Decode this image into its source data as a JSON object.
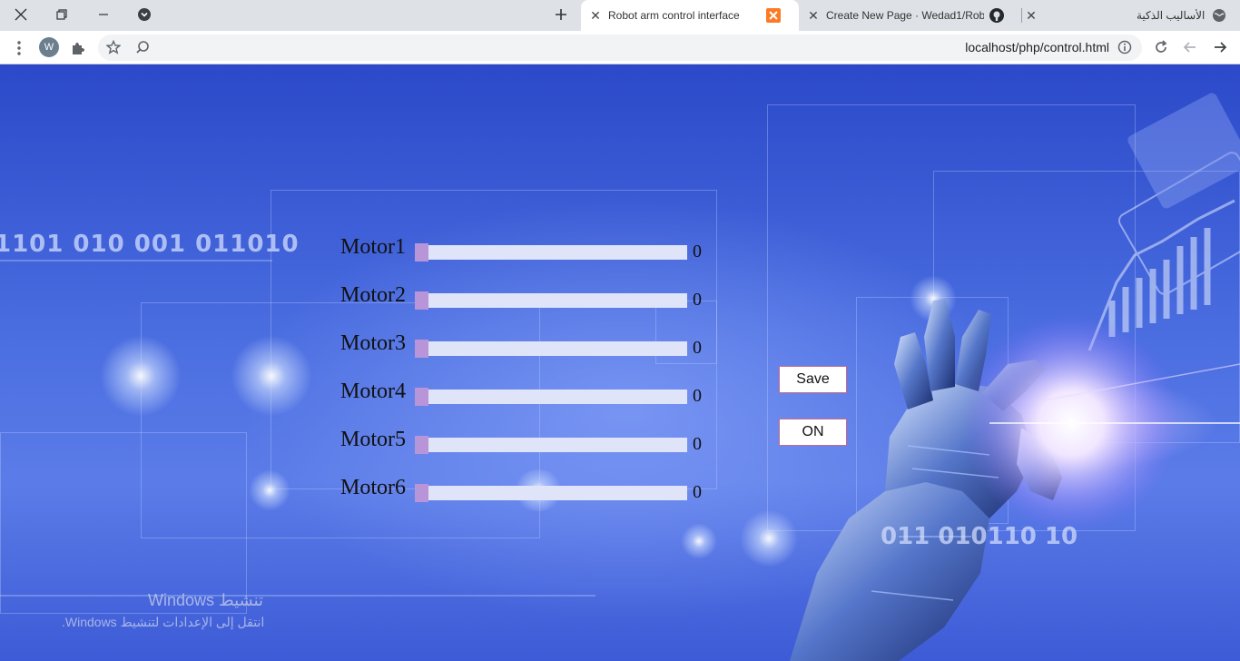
{
  "browser": {
    "tabs": [
      {
        "title": "Robot arm control interface",
        "active": true
      },
      {
        "title": "Create New Page · Wedad1/Robo",
        "active": false
      },
      {
        "title": "الأساليب الذكية",
        "active": false
      }
    ],
    "url": "localhost/php/control.html",
    "profile_initial": "W",
    "icons": {
      "window_close": "close-icon",
      "window_restore": "restore-icon",
      "window_minimize": "minimize-icon",
      "tab_search": "tab-search-icon",
      "new_tab": "plus-icon",
      "menu": "kebab-menu-icon",
      "extensions": "puzzle-icon",
      "bookmark": "star-icon",
      "lens": "lens-search-icon",
      "site_info": "info-icon",
      "reload": "reload-icon",
      "back": "arrow-left-icon",
      "forward": "arrow-right-icon"
    }
  },
  "page": {
    "background_binary": [
      "1101  010  001  011010",
      "011  010110  10"
    ],
    "motors": [
      {
        "label": "Motor1",
        "value": "0",
        "position": 0
      },
      {
        "label": "Motor2",
        "value": "0",
        "position": 0
      },
      {
        "label": "Motor3",
        "value": "0",
        "position": 0
      },
      {
        "label": "Motor4",
        "value": "0",
        "position": 0
      },
      {
        "label": "Motor5",
        "value": "0",
        "position": 0
      },
      {
        "label": "Motor6",
        "value": "0",
        "position": 0
      }
    ],
    "buttons": {
      "save": "Save",
      "on": "ON"
    },
    "colors": {
      "slider_thumb": "#b894d9",
      "slider_track": "#dfe4f8",
      "button_border": "#c86a8a"
    }
  },
  "windows_watermark": {
    "title": "تنشيط Windows",
    "subtitle": "انتقل إلى الإعدادات لتنشيط Windows."
  }
}
